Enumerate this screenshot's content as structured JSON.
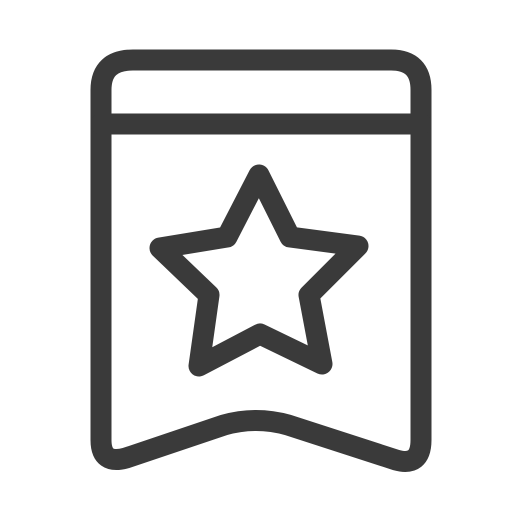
{
  "icon": {
    "name": "bookmark-star-icon",
    "color": "#3a3a3a",
    "background": "#ffffff"
  }
}
